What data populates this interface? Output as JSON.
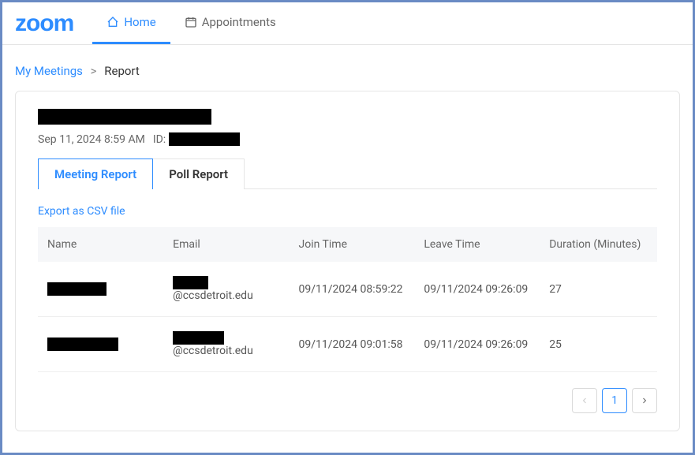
{
  "brand": "zoom",
  "nav": {
    "home": "Home",
    "appointments": "Appointments"
  },
  "breadcrumb": {
    "my_meetings": "My Meetings",
    "sep": ">",
    "current": "Report"
  },
  "meeting": {
    "date_time": "Sep 11, 2024 8:59 AM",
    "id_label": "ID:"
  },
  "tabs": {
    "meeting_report": "Meeting Report",
    "poll_report": "Poll Report"
  },
  "export_link": "Export as CSV file",
  "columns": {
    "name": "Name",
    "email": "Email",
    "join_time": "Join Time",
    "leave_time": "Leave Time",
    "duration": "Duration (Minutes)"
  },
  "rows": [
    {
      "email_suffix": "@ccsdetroit.edu",
      "join": "09/11/2024 08:59:22",
      "leave": "09/11/2024 09:26:09",
      "duration": "27"
    },
    {
      "email_suffix": "@ccsdetroit.edu",
      "join": "09/11/2024 09:01:58",
      "leave": "09/11/2024 09:26:09",
      "duration": "25"
    }
  ],
  "pagination": {
    "current": "1"
  }
}
